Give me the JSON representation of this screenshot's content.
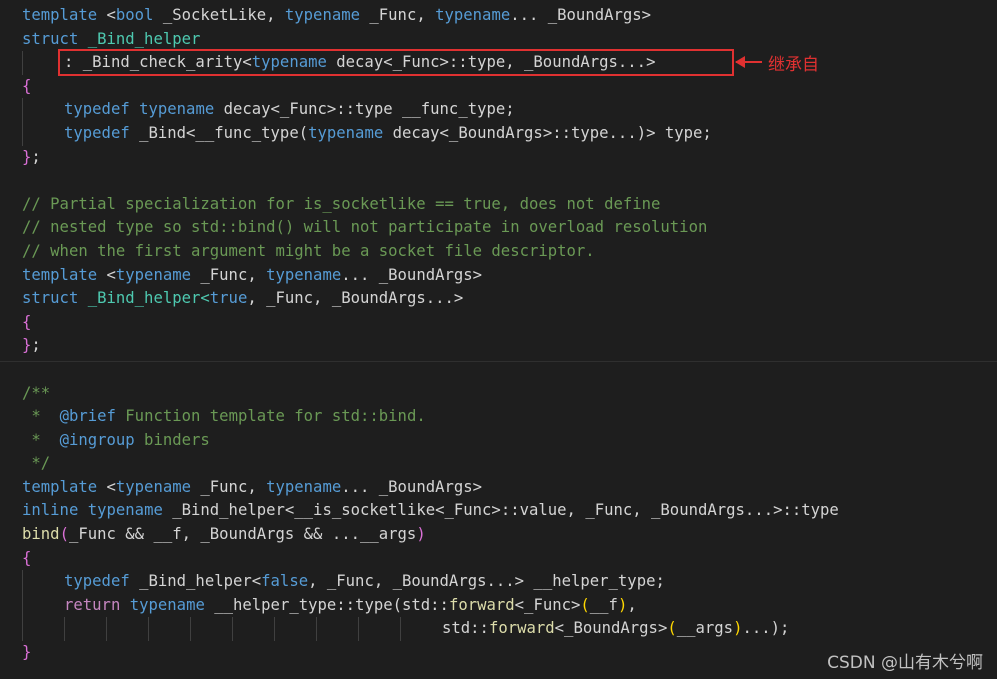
{
  "colors": {
    "background": "#1e1e1e",
    "keyword": "#569cd6",
    "type": "#4ec9b0",
    "comment": "#6a9955",
    "function": "#dcdcaa",
    "control": "#c586c0",
    "text": "#d4d4d4",
    "param": "#9cdcfe",
    "bracket1": "#da70d6",
    "bracket2": "#ffd700",
    "annotation": "#e03131"
  },
  "code_lines": [
    {
      "indent": 0,
      "tokens": [
        {
          "t": "template",
          "c": "keyword"
        },
        {
          "t": " <",
          "c": "text"
        },
        {
          "t": "bool",
          "c": "keyword"
        },
        {
          "t": " _SocketLike, ",
          "c": "text"
        },
        {
          "t": "typename",
          "c": "keyword"
        },
        {
          "t": " _Func, ",
          "c": "text"
        },
        {
          "t": "typename",
          "c": "keyword"
        },
        {
          "t": "... _BoundArgs>",
          "c": "text"
        }
      ]
    },
    {
      "indent": 0,
      "tokens": [
        {
          "t": "struct",
          "c": "keyword"
        },
        {
          "t": " _Bind_helper",
          "c": "type"
        }
      ]
    },
    {
      "indent": 1,
      "tokens": [
        {
          "t": ": _Bind_check_arity<",
          "c": "text"
        },
        {
          "t": "typename",
          "c": "keyword"
        },
        {
          "t": " decay<_Func>::type, _BoundArgs...>",
          "c": "text"
        }
      ]
    },
    {
      "indent": 0,
      "tokens": [
        {
          "t": "{",
          "c": "bracket1"
        }
      ]
    },
    {
      "indent": 1,
      "tokens": [
        {
          "t": "typedef",
          "c": "keyword"
        },
        {
          "t": " ",
          "c": "text"
        },
        {
          "t": "typename",
          "c": "keyword"
        },
        {
          "t": " decay<_Func>::type __func_type;",
          "c": "text"
        }
      ]
    },
    {
      "indent": 1,
      "tokens": [
        {
          "t": "typedef",
          "c": "keyword"
        },
        {
          "t": " _Bind<__func_type(",
          "c": "text"
        },
        {
          "t": "typename",
          "c": "keyword"
        },
        {
          "t": " decay<_BoundArgs>::type...)> type;",
          "c": "text"
        }
      ]
    },
    {
      "indent": 0,
      "tokens": [
        {
          "t": "}",
          "c": "bracket1"
        },
        {
          "t": ";",
          "c": "text"
        }
      ]
    },
    {
      "indent": 0,
      "tokens": []
    },
    {
      "indent": 0,
      "tokens": [
        {
          "t": "// Partial specialization for is_socketlike == true, does not define",
          "c": "comment"
        }
      ]
    },
    {
      "indent": 0,
      "tokens": [
        {
          "t": "// nested type so std::bind() will not participate in overload resolution",
          "c": "comment"
        }
      ]
    },
    {
      "indent": 0,
      "tokens": [
        {
          "t": "// when the first argument might be a socket file descriptor.",
          "c": "comment"
        }
      ]
    },
    {
      "indent": 0,
      "tokens": [
        {
          "t": "template",
          "c": "keyword"
        },
        {
          "t": " <",
          "c": "text"
        },
        {
          "t": "typename",
          "c": "keyword"
        },
        {
          "t": " _Func, ",
          "c": "text"
        },
        {
          "t": "typename",
          "c": "keyword"
        },
        {
          "t": "... _BoundArgs>",
          "c": "text"
        }
      ]
    },
    {
      "indent": 0,
      "tokens": [
        {
          "t": "struct",
          "c": "keyword"
        },
        {
          "t": " _Bind_helper<",
          "c": "type"
        },
        {
          "t": "true",
          "c": "keyword"
        },
        {
          "t": ", _Func, _BoundArgs...>",
          "c": "text"
        }
      ]
    },
    {
      "indent": 0,
      "tokens": [
        {
          "t": "{",
          "c": "bracket1"
        }
      ]
    },
    {
      "indent": 0,
      "tokens": [
        {
          "t": "}",
          "c": "bracket1"
        },
        {
          "t": ";",
          "c": "text"
        }
      ]
    },
    {
      "indent": 0,
      "tokens": []
    },
    {
      "indent": 0,
      "tokens": [
        {
          "t": "/**",
          "c": "comment"
        }
      ]
    },
    {
      "indent": 0,
      "tokens": [
        {
          "t": " *  ",
          "c": "comment"
        },
        {
          "t": "@brief",
          "c": "keyword"
        },
        {
          "t": " Function template for std::bind.",
          "c": "comment"
        }
      ]
    },
    {
      "indent": 0,
      "tokens": [
        {
          "t": " *  ",
          "c": "comment"
        },
        {
          "t": "@ingroup",
          "c": "keyword"
        },
        {
          "t": " binders",
          "c": "comment"
        }
      ]
    },
    {
      "indent": 0,
      "tokens": [
        {
          "t": " */",
          "c": "comment"
        }
      ]
    },
    {
      "indent": 0,
      "tokens": [
        {
          "t": "template",
          "c": "keyword"
        },
        {
          "t": " <",
          "c": "text"
        },
        {
          "t": "typename",
          "c": "keyword"
        },
        {
          "t": " _Func, ",
          "c": "text"
        },
        {
          "t": "typename",
          "c": "keyword"
        },
        {
          "t": "... _BoundArgs>",
          "c": "text"
        }
      ]
    },
    {
      "indent": 0,
      "tokens": [
        {
          "t": "inline",
          "c": "keyword"
        },
        {
          "t": " ",
          "c": "text"
        },
        {
          "t": "typename",
          "c": "keyword"
        },
        {
          "t": " _Bind_helper<__is_socketlike<_Func>::value, _Func, _BoundArgs...>::type",
          "c": "text"
        }
      ]
    },
    {
      "indent": 0,
      "tokens": [
        {
          "t": "bind",
          "c": "function"
        },
        {
          "t": "(",
          "c": "bracket1"
        },
        {
          "t": "_Func && __f, _BoundArgs && ...__args",
          "c": "text"
        },
        {
          "t": ")",
          "c": "bracket1"
        }
      ]
    },
    {
      "indent": 0,
      "tokens": [
        {
          "t": "{",
          "c": "bracket1"
        }
      ]
    },
    {
      "indent": 1,
      "tokens": [
        {
          "t": "typedef",
          "c": "keyword"
        },
        {
          "t": " _Bind_helper<",
          "c": "text"
        },
        {
          "t": "false",
          "c": "keyword"
        },
        {
          "t": ", _Func, _BoundArgs...> __helper_type;",
          "c": "text"
        }
      ]
    },
    {
      "indent": 1,
      "tokens": [
        {
          "t": "return",
          "c": "control"
        },
        {
          "t": " ",
          "c": "text"
        },
        {
          "t": "typename",
          "c": "keyword"
        },
        {
          "t": " __helper_type::type(std::",
          "c": "text"
        },
        {
          "t": "forward",
          "c": "function"
        },
        {
          "t": "<_Func>",
          "c": "text"
        },
        {
          "t": "(",
          "c": "bracket2"
        },
        {
          "t": "__f",
          "c": "text"
        },
        {
          "t": ")",
          "c": "bracket2"
        },
        {
          "t": ",",
          "c": "text"
        }
      ]
    },
    {
      "indent": 10,
      "tokens": [
        {
          "t": "std::",
          "c": "text"
        },
        {
          "t": "forward",
          "c": "function"
        },
        {
          "t": "<_BoundArgs>",
          "c": "text"
        },
        {
          "t": "(",
          "c": "bracket2"
        },
        {
          "t": "__args",
          "c": "text"
        },
        {
          "t": ")",
          "c": "bracket2"
        },
        {
          "t": "...);",
          "c": "text"
        }
      ]
    },
    {
      "indent": 0,
      "tokens": [
        {
          "t": "}",
          "c": "bracket1"
        }
      ]
    }
  ],
  "annotation": {
    "label": "继承自"
  },
  "watermark": "CSDN @山有木兮啊"
}
